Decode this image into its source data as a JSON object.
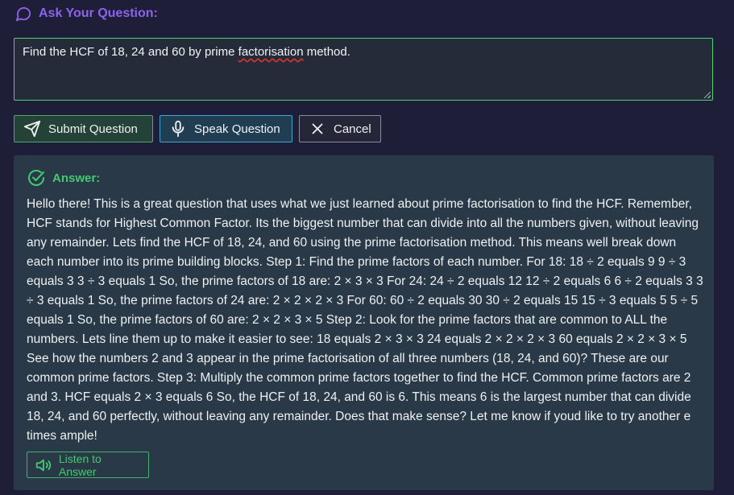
{
  "header": {
    "icon": "chat-bubble-icon",
    "title": "Ask Your Question:",
    "color": "#8d63ec"
  },
  "question": {
    "text_before": "Find the HCF of 18, 24 and 60 by prime ",
    "text_misspelled": "factorisation",
    "text_after": " method."
  },
  "buttons": {
    "submit_label": "Submit Question",
    "speak_label": "Speak Question",
    "cancel_label": "Cancel"
  },
  "answer": {
    "title": "Answer:",
    "body": "Hello there! This is a great question that uses what we just learned about prime factorisation to find the HCF. Remember, HCF stands for Highest Common Factor. Its the biggest number that can divide into all the numbers given, without leaving any remainder. Lets find the HCF of 18, 24, and 60 using the prime factorisation method. This means well break down each number into its prime building blocks. Step 1: Find the prime factors of each number. For 18: 18 ÷ 2 equals 9 9 ÷ 3 equals 3 3 ÷ 3 equals 1 So, the prime factors of 18 are: 2 × 3 × 3 For 24: 24 ÷ 2 equals 12 12 ÷ 2 equals 6 6 ÷ 2 equals 3 3 ÷ 3 equals 1 So, the prime factors of 24 are: 2 × 2 × 2 × 3 For 60: 60 ÷ 2 equals 30 30 ÷ 2 equals 15 15 ÷ 3 equals 5 5 ÷ 5 equals 1 So, the prime factors of 60 are: 2 × 2 × 3 × 5 Step 2: Look for the prime factors that are common to ALL the numbers. Lets line them up to make it easier to see: 18 equals 2 × 3 × 3 24 equals 2 × 2 × 2 × 3 60 equals 2 × 2 × 3 × 5 See how the numbers 2 and 3 appear in the prime factorisation of all three numbers (18, 24, and 60)? These are our common prime factors. Step 3: Multiply the common prime factors together to find the HCF. Common prime factors are 2 and 3. HCF equals 2 × 3 equals 6 So, the HCF of 18, 24, and 60 is 6. This means 6 is the largest number that can divide 18, 24, and 60 perfectly, without leaving any remainder. Does that make sense? Let me know if youd like to try another e times ample!",
    "listen_label": "Listen to Answer",
    "accent_color": "#43c973"
  }
}
